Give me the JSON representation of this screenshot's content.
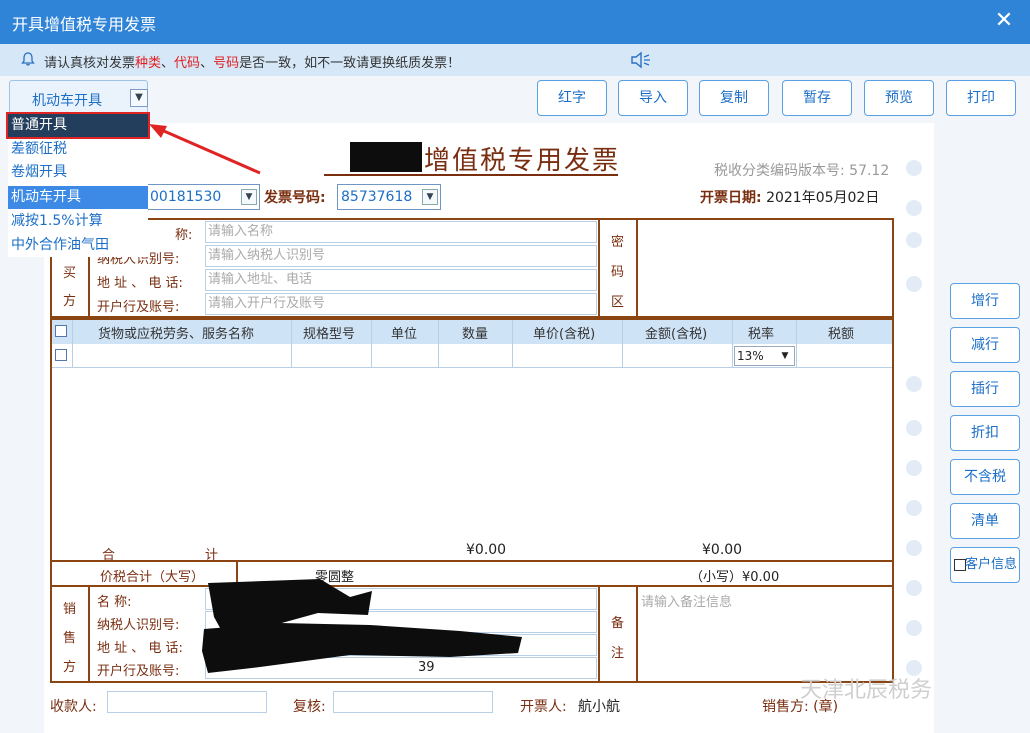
{
  "window": {
    "title": "开具增值税专用发票",
    "close": "✕"
  },
  "notice": {
    "prefix": "请认真核对发票",
    "w1": "种类",
    "sep1": "、",
    "w2": "代码",
    "sep2": "、",
    "w3": "号码",
    "suffix": "是否一致，如不一致请更换纸质发票！"
  },
  "mode_select": {
    "value": "机动车开具",
    "options": [
      "普通开具",
      "差额征税",
      "卷烟开具",
      "机动车开具",
      "减按1.5%计算",
      "中外合作油气田"
    ]
  },
  "toolbar": {
    "red": "红字",
    "import": "导入",
    "copy": "复制",
    "save": "暂存",
    "preview": "预览",
    "print": "打印"
  },
  "side_buttons": {
    "add_row": "增行",
    "del_row": "减行",
    "insert_row": "插行",
    "discount": "折扣",
    "no_tax": "不含税",
    "clear": "清单",
    "customer": "客户信息"
  },
  "invoice": {
    "title": "增值税专用发票",
    "version": "税收分类编码版本号: 57.12",
    "code_value": "00181530",
    "number_label": "发票号码:",
    "number_value": "85737618",
    "date_label": "开票日期:",
    "date_value": "2021年05月02日",
    "buyer": {
      "side": [
        "买",
        "方"
      ],
      "name_label": "称:",
      "taxid_label": "纳税人识别号:",
      "addr_label": "地 址 、 电 话:",
      "bank_label": "开户行及账号:",
      "name_ph": "请输入名称",
      "taxid_ph": "请输入纳税人识别号",
      "addr_ph": "请输入地址、电话",
      "bank_ph": "请输入开户行及账号"
    },
    "cipher": [
      "密",
      "码",
      "区"
    ],
    "columns": [
      "货物或应税劳务、服务名称",
      "规格型号",
      "单位",
      "数量",
      "单价(含税)",
      "金额(含税)",
      "税率",
      "税额"
    ],
    "tax_rate": "13%",
    "total": {
      "label_a": "合",
      "label_b": "计",
      "amount": "¥0.00",
      "tax": "¥0.00"
    },
    "grand": {
      "label": "价税合计（大写）",
      "upper": "零圆整",
      "lower": "（小写）¥0.00"
    },
    "seller": {
      "side": [
        "销",
        "售",
        "方"
      ],
      "name_label": "名 称:",
      "taxid_label": "纳税人识别号:",
      "addr_label": "地 址 、 电 话:",
      "bank_label": "开户行及账号:",
      "bank_tail": "39"
    },
    "remark": [
      "备",
      "注"
    ],
    "remark_ph": "请输入备注信息",
    "payee_label": "收款人:",
    "review_label": "复核:",
    "drawer_label": "开票人:",
    "drawer_value": "航小航",
    "seller_sign": "销售方: (章)"
  },
  "watermark": "天津北辰税务",
  "colors": {
    "titlebar": "#2f84d8",
    "accent": "#1c6fc7",
    "invoice_brown": "#7a2e10",
    "highlight_red": "#e02424"
  }
}
